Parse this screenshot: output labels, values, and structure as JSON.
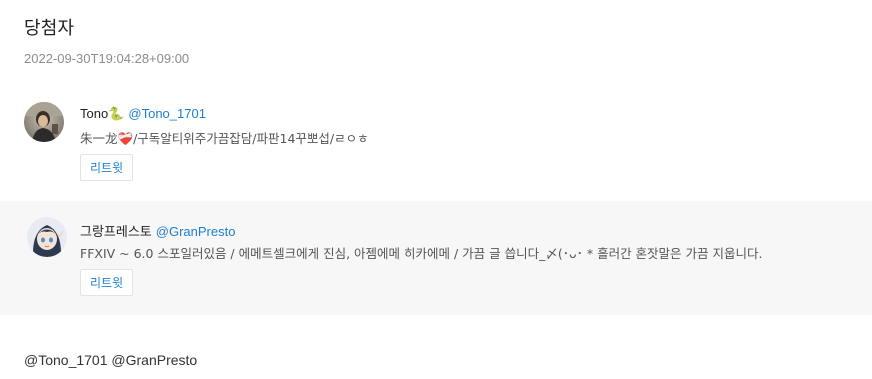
{
  "header": {
    "title": "당첨자",
    "timestamp": "2022-09-30T19:04:28+09:00"
  },
  "winners": [
    {
      "display_name": "Tono🐍",
      "handle": "@Tono_1701",
      "bio": "朱一龙❤️‍🩹/구독알티위주가끔잡담/파판14꾸뽀섭/ㄹㅇㅎ",
      "retweet_label": "리트윗",
      "avatar_icon": "avatar-photo"
    },
    {
      "display_name": "그랑프레스토",
      "handle": "@GranPresto",
      "bio": "FFXIV ~ 6.0 스포일러있음 / 에메트셀크에게 진심, 아젬에메 히카에메 / 가끔 글 씁니다_〆(･ᴗ･ * 흘러간 혼잣말은 가끔 지웁니다.",
      "retweet_label": "리트윗",
      "avatar_icon": "avatar-anime-girl"
    }
  ],
  "footer": {
    "mentions": "@Tono_1701 @GranPresto"
  },
  "colors": {
    "accent": "#1d7fd0",
    "alt_row_bg": "#f7f7f7",
    "muted_text": "#8c8c8c"
  }
}
